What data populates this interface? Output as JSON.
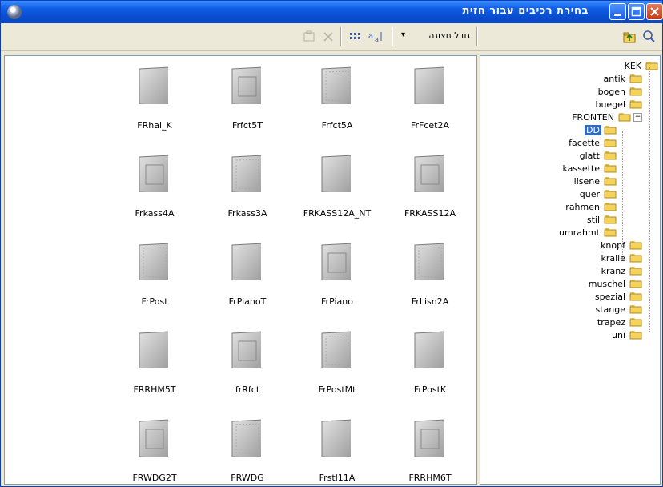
{
  "window": {
    "title": "בחירת רכיבים עבור חזית"
  },
  "toolbar": {
    "view_size_label": "גודל תצוגה",
    "view_size_arrow": "▾"
  },
  "thumbnails": [
    {
      "name": "FRhal_K"
    },
    {
      "name": "Frfct5T"
    },
    {
      "name": "Frfct5A"
    },
    {
      "name": "FrFcet2A"
    },
    {
      "name": "Frkass4A"
    },
    {
      "name": "Frkass3A"
    },
    {
      "name": "FRKASS12A_NT"
    },
    {
      "name": "FRKASS12A"
    },
    {
      "name": "FrPost"
    },
    {
      "name": "FrPianoT"
    },
    {
      "name": "FrPiano"
    },
    {
      "name": "FrLisn2A"
    },
    {
      "name": "FRRHM5T"
    },
    {
      "name": "frRfct"
    },
    {
      "name": "FrPostMt"
    },
    {
      "name": "FrPostK"
    },
    {
      "name": "FRWDG2T"
    },
    {
      "name": "FRWDG"
    },
    {
      "name": "Frstl11A"
    },
    {
      "name": "FRRHM6T"
    }
  ],
  "tree": {
    "root": "KEK",
    "items": [
      {
        "label": "antik"
      },
      {
        "label": "bogen"
      },
      {
        "label": "buegel"
      },
      {
        "label": "FRONTEN"
      },
      {
        "label": "DD"
      },
      {
        "label": "facette"
      },
      {
        "label": "glatt"
      },
      {
        "label": "kassette"
      },
      {
        "label": "lisene"
      },
      {
        "label": "quer"
      },
      {
        "label": "rahmen"
      },
      {
        "label": "stil"
      },
      {
        "label": "umrahmt"
      },
      {
        "label": "knopf"
      },
      {
        "label": "kralle"
      },
      {
        "label": "kranz"
      },
      {
        "label": "muschel"
      },
      {
        "label": "spezial"
      },
      {
        "label": "stange"
      },
      {
        "label": "trapez"
      },
      {
        "label": "uni"
      }
    ],
    "selected": "DD",
    "expand_toggle": "−"
  },
  "colors": {
    "titlebar": "#0a4ed0",
    "selection": "#316ac5",
    "folder": "#f5d25b"
  }
}
